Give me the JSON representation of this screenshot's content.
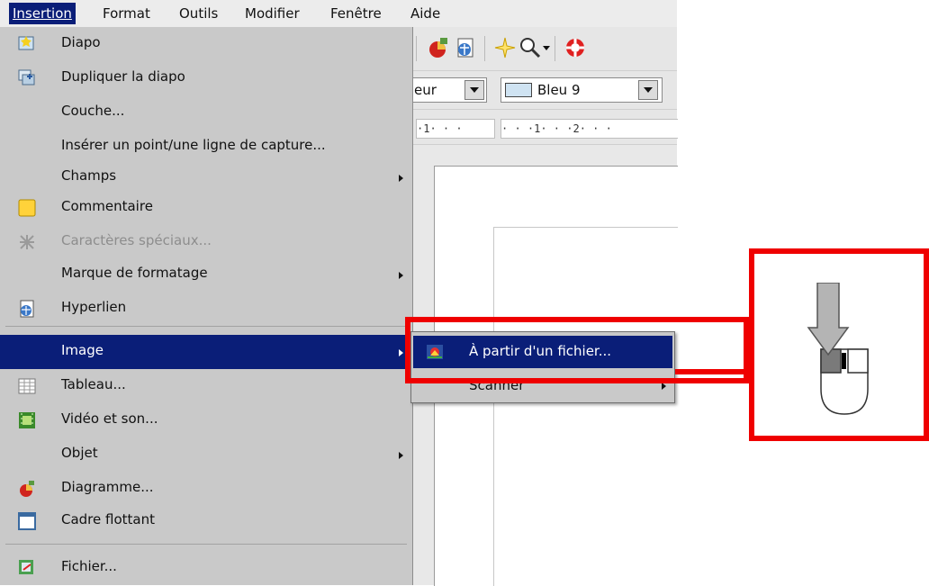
{
  "menubar": {
    "items": [
      "Insertion",
      "Format",
      "Outils",
      "Modifier",
      "Fenêtre",
      "Aide"
    ],
    "active": "Insertion"
  },
  "toolbar": {
    "partial_combo_text": "eur",
    "color_combo_text": "Bleu 9",
    "color_swatch": "#cfe3f2"
  },
  "ruler": {
    "segment1": "·1·  ·  ·",
    "segment2": "· · ·1· · ·2· · ·"
  },
  "menu": {
    "items": [
      {
        "label": "Diapo",
        "icon": "slide-icon"
      },
      {
        "label": "Dupliquer la diapo",
        "icon": "duplicate-slide-icon"
      },
      {
        "label": "Couche...",
        "icon": ""
      },
      {
        "label": "Insérer un point/une ligne de capture...",
        "icon": ""
      },
      {
        "label": "Champs",
        "icon": "",
        "submenu": true
      },
      {
        "label": "Commentaire",
        "icon": "comment-icon"
      },
      {
        "label": "Caractères spéciaux...",
        "icon": "special-characters-icon",
        "disabled": true
      },
      {
        "label": "Marque de formatage",
        "icon": "",
        "submenu": true
      },
      {
        "label": "Hyperlien",
        "icon": "hyperlink-icon"
      },
      {
        "label": "Image",
        "icon": "",
        "submenu": true,
        "selected": true
      },
      {
        "label": "Tableau...",
        "icon": "table-icon"
      },
      {
        "label": "Vidéo et son...",
        "icon": "video-sound-icon"
      },
      {
        "label": "Objet",
        "icon": "",
        "submenu": true
      },
      {
        "label": "Diagramme...",
        "icon": "chart-icon"
      },
      {
        "label": "Cadre flottant",
        "icon": "floating-frame-icon"
      },
      {
        "label": "Fichier...",
        "icon": "file-icon"
      }
    ]
  },
  "submenu": {
    "items": [
      {
        "label": "À partir d'un fichier...",
        "icon": "image-file-icon",
        "selected": true
      },
      {
        "label": "Scanner",
        "submenu": true
      }
    ]
  },
  "annotation": {
    "color": "#ef0000",
    "icon": "mouse-left-click-icon"
  },
  "colors": {
    "menu_bg": "#c9c9c9",
    "selection_bg": "#0a1e78",
    "highlight_red": "#ef0000"
  }
}
